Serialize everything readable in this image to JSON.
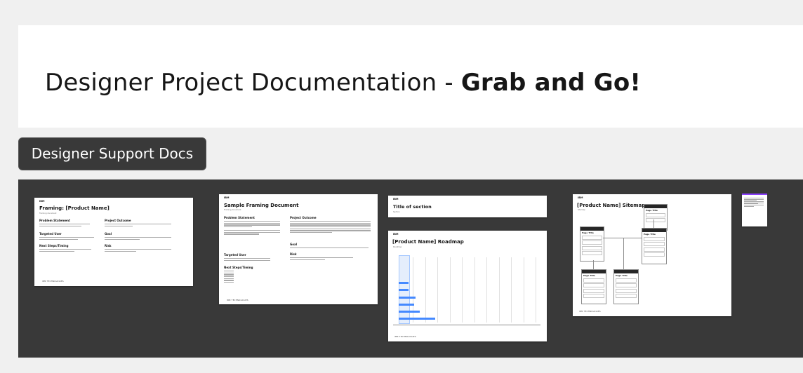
{
  "header": {
    "title_regular": "Designer Project Documentation - ",
    "title_bold": "Grab and Go!"
  },
  "section": {
    "label": "Designer Support Docs"
  },
  "docs": [
    {
      "logo": "IBM",
      "title": "Framing: [Product Name]",
      "subtitle": "Framing document",
      "sections": [
        "Problem Statement",
        "Project Outcome",
        "Targeted User",
        "Goal",
        "Next Steps/Timing",
        "Risk"
      ],
      "footer": "IBM TECHNOLOGIES"
    },
    {
      "logo": "IBM",
      "title": "Sample Framing Document",
      "subtitle": "Framing document",
      "sections": [
        "Problem Statement",
        "Project Outcome",
        "Targeted User",
        "Goal",
        "Next Steps/Timing",
        "Risk"
      ],
      "footer": "IBM TECHNOLOGIES"
    },
    {
      "logo": "IBM",
      "title": "Title of section",
      "subtitle": "Section"
    },
    {
      "logo": "IBM",
      "title": "[Product Name] Roadmap",
      "subtitle": "Roadmap",
      "footer": "IBM TECHNOLOGIES"
    },
    {
      "logo": "IBM",
      "title": "[Product Name] Sitemap",
      "subtitle": "Sitemap",
      "box_title": "Page Title",
      "footer": "IBM TECHNOLOGIES"
    }
  ],
  "colors": {
    "canvas": "#393939",
    "accent": "#4589ff",
    "thumb_accent": "#8a3ffc"
  }
}
